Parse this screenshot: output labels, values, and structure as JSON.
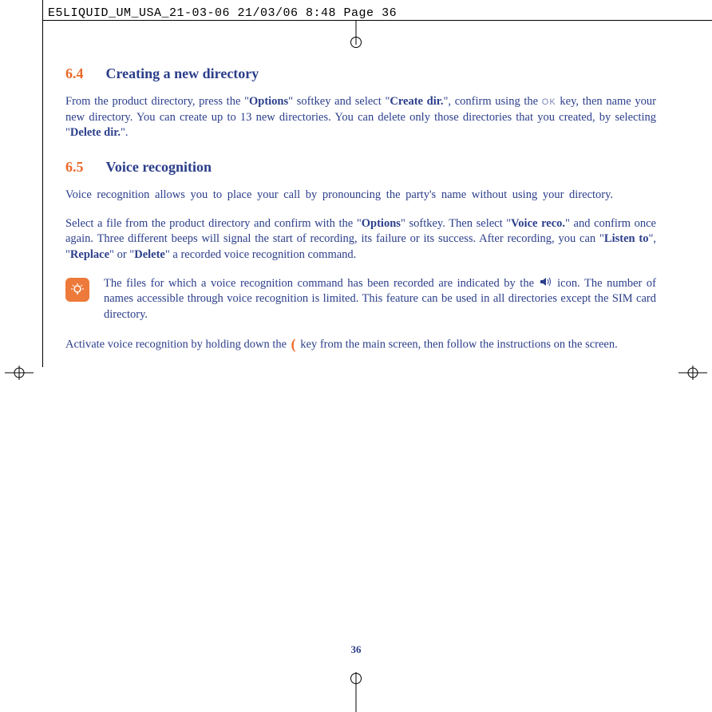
{
  "meta": {
    "header": "E5LIQUID_UM_USA_21-03-06  21/03/06  8:48  Page 36"
  },
  "section64": {
    "num": "6.4",
    "title": "Creating a new directory",
    "p1a": "From the product directory, press the \"",
    "p1b": "Options",
    "p1c": "\" softkey and select \"",
    "p1d": "Create dir.",
    "p1e": "\", confirm using the ",
    "p1f": "OK",
    "p1g": " key, then name your new directory. You can create up to 13 new directories. You can delete only those directories that you created, by selecting \"",
    "p1h": "Delete dir.",
    "p1i": "\"."
  },
  "section65": {
    "num": "6.5",
    "title": "Voice recognition",
    "p1": "Voice recognition allows you to place your call by pronouncing the party's name without using your directory.",
    "p2a": "Select a file from the product directory and confirm with the \"",
    "p2b": "Options",
    "p2c": "\" softkey. Then select \"",
    "p2d": "Voice reco.",
    "p2e": "\" and confirm once again. Three different beeps will signal the start of recording, its failure or its success. After recording, you can \"",
    "p2f": "Listen to",
    "p2g": "\", \"",
    "p2h": "Replace",
    "p2i": "\" or \"",
    "p2j": "Delete",
    "p2k": "\" a recorded voice recognition command.",
    "tipA": "The files for which a voice recognition command has been recorded are indicated by the ",
    "tipB": " icon. The number of names accessible through voice recognition is limited. This feature can be used in all directories except the SIM card directory.",
    "p3a": "Activate voice recognition by holding down the ",
    "p3b": " key from the main screen, then follow the instructions on the screen."
  },
  "pageNumber": "36"
}
